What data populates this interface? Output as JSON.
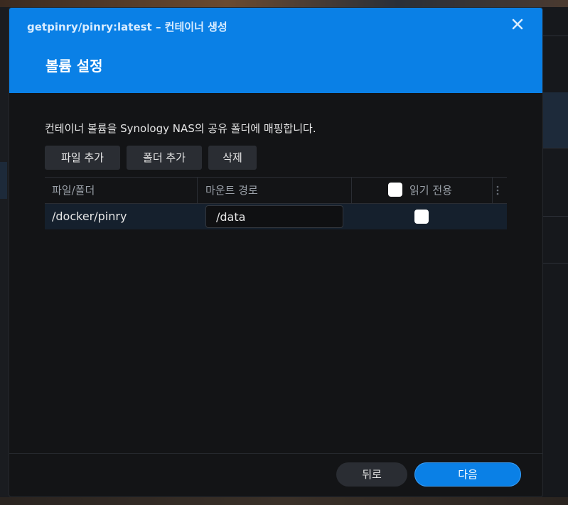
{
  "dialog": {
    "title": "getpinry/pinry:latest – 컨테이너 생성",
    "step_title": "볼륨 설정",
    "description": "컨테이너 볼륨을 Synology NAS의 공유 폴더에 매핑합니다."
  },
  "toolbar": {
    "add_file": "파일 추가",
    "add_folder": "폴더 추가",
    "delete": "삭제"
  },
  "table": {
    "headers": {
      "file_folder": "파일/폴더",
      "mount_path": "마운트 경로",
      "read_only": "읽기 전용"
    },
    "rows": [
      {
        "path": "/docker/pinry",
        "mount": "/data",
        "read_only": false
      }
    ]
  },
  "footer": {
    "back": "뒤로",
    "next": "다음"
  },
  "colors": {
    "accent": "#0a80e6",
    "dialog_bg": "#131416",
    "button_bg": "#2a2d33",
    "row_selected": "#15202d"
  }
}
